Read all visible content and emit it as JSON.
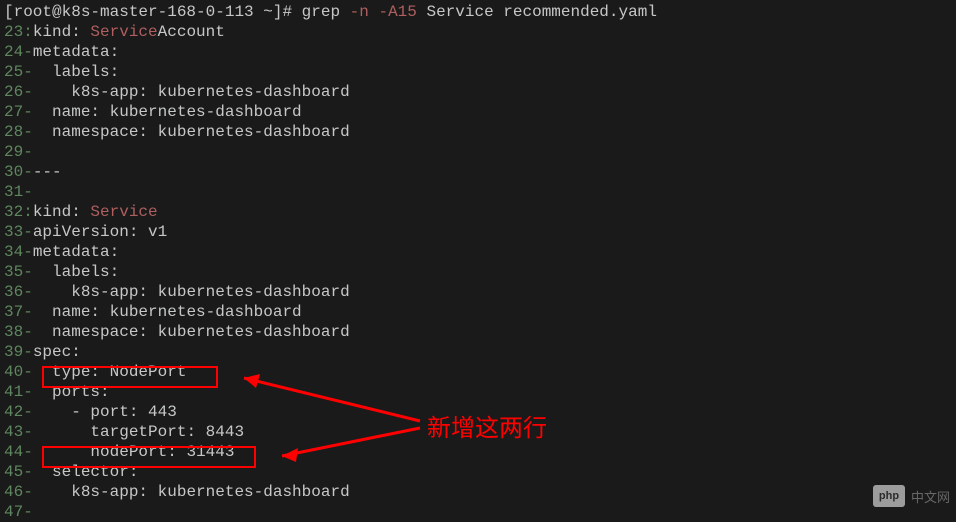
{
  "prompt": "[root@k8s-master-168-0-113 ~]# grep ",
  "grep_flags": "-n -A15",
  "grep_args": " Service recommended.yaml",
  "lines": [
    {
      "num": "23",
      "sep": ":",
      "prefix": "kind: ",
      "highlight": "Service",
      "suffix": "Account"
    },
    {
      "num": "24",
      "sep": "-",
      "prefix": "metadata:",
      "highlight": "",
      "suffix": ""
    },
    {
      "num": "25",
      "sep": "-",
      "prefix": "  labels:",
      "highlight": "",
      "suffix": ""
    },
    {
      "num": "26",
      "sep": "-",
      "prefix": "    k8s-app: kubernetes-dashboard",
      "highlight": "",
      "suffix": ""
    },
    {
      "num": "27",
      "sep": "-",
      "prefix": "  name: kubernetes-dashboard",
      "highlight": "",
      "suffix": ""
    },
    {
      "num": "28",
      "sep": "-",
      "prefix": "  namespace: kubernetes-dashboard",
      "highlight": "",
      "suffix": ""
    },
    {
      "num": "29",
      "sep": "-",
      "prefix": "",
      "highlight": "",
      "suffix": ""
    },
    {
      "num": "30",
      "sep": "-",
      "prefix": "---",
      "highlight": "",
      "suffix": ""
    },
    {
      "num": "31",
      "sep": "-",
      "prefix": "",
      "highlight": "",
      "suffix": ""
    },
    {
      "num": "32",
      "sep": ":",
      "prefix": "kind: ",
      "highlight": "Service",
      "suffix": ""
    },
    {
      "num": "33",
      "sep": "-",
      "prefix": "apiVersion: v1",
      "highlight": "",
      "suffix": ""
    },
    {
      "num": "34",
      "sep": "-",
      "prefix": "metadata:",
      "highlight": "",
      "suffix": ""
    },
    {
      "num": "35",
      "sep": "-",
      "prefix": "  labels:",
      "highlight": "",
      "suffix": ""
    },
    {
      "num": "36",
      "sep": "-",
      "prefix": "    k8s-app: kubernetes-dashboard",
      "highlight": "",
      "suffix": ""
    },
    {
      "num": "37",
      "sep": "-",
      "prefix": "  name: kubernetes-dashboard",
      "highlight": "",
      "suffix": ""
    },
    {
      "num": "38",
      "sep": "-",
      "prefix": "  namespace: kubernetes-dashboard",
      "highlight": "",
      "suffix": ""
    },
    {
      "num": "39",
      "sep": "-",
      "prefix": "spec:",
      "highlight": "",
      "suffix": ""
    },
    {
      "num": "40",
      "sep": "-",
      "prefix": "  type: NodePort",
      "highlight": "",
      "suffix": ""
    },
    {
      "num": "41",
      "sep": "-",
      "prefix": "  ports:",
      "highlight": "",
      "suffix": ""
    },
    {
      "num": "42",
      "sep": "-",
      "prefix": "    - port: 443",
      "highlight": "",
      "suffix": ""
    },
    {
      "num": "43",
      "sep": "-",
      "prefix": "      targetPort: 8443",
      "highlight": "",
      "suffix": ""
    },
    {
      "num": "44",
      "sep": "-",
      "prefix": "      nodePort: 31443",
      "highlight": "",
      "suffix": ""
    },
    {
      "num": "45",
      "sep": "-",
      "prefix": "  selector:",
      "highlight": "",
      "suffix": ""
    },
    {
      "num": "46",
      "sep": "-",
      "prefix": "    k8s-app: kubernetes-dashboard",
      "highlight": "",
      "suffix": ""
    },
    {
      "num": "47",
      "sep": "-",
      "prefix": "",
      "highlight": "",
      "suffix": ""
    }
  ],
  "annotation_text": "新增这两行",
  "watermark": {
    "logo": "php",
    "text": "中文网"
  }
}
